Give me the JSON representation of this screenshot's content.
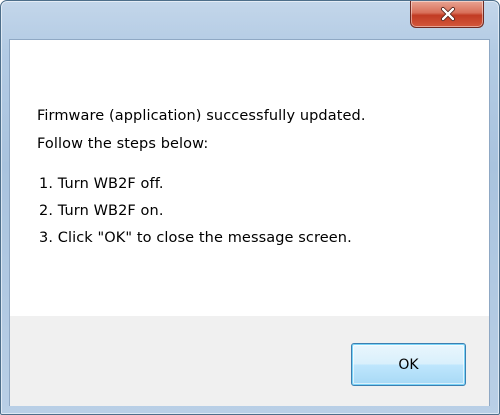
{
  "dialog": {
    "title": "",
    "close_icon": "close-icon",
    "message": [
      "Firmware (application) successfully updated.",
      "Follow the steps below:",
      "1. Turn WB2F off.",
      "2. Turn WB2F on.",
      "3. Click \"OK\" to close the message screen."
    ],
    "ok_label": "OK"
  },
  "colors": {
    "frame": "#b3cbe4",
    "close_button": "#c13b23",
    "button_area": "#f0f0f0",
    "ok_button_border": "#3c7fb1"
  }
}
